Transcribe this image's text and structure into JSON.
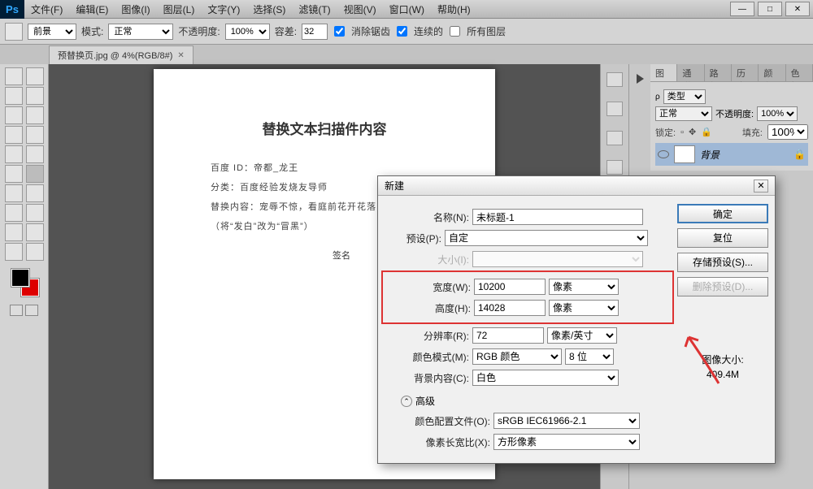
{
  "menu": {
    "file": "文件(F)",
    "edit": "编辑(E)",
    "image": "图像(I)",
    "layer": "图层(L)",
    "type": "文字(Y)",
    "select": "选择(S)",
    "filter": "滤镜(T)",
    "view": "视图(V)",
    "window": "窗口(W)",
    "help": "帮助(H)"
  },
  "options": {
    "fg": "前景",
    "mode": "模式:",
    "mode_val": "正常",
    "opacity": "不透明度:",
    "opacity_val": "100%",
    "tolerance": "容差:",
    "tol_val": "32",
    "antialias": "消除锯齿",
    "contig": "连续的",
    "allLayers": "所有图层"
  },
  "tab": {
    "title": "预替换页.jpg @ 4%(RGB/8#)"
  },
  "doc": {
    "title": "替换文本扫描件内容",
    "line1": "百度 ID：帝都_龙王",
    "line2": "分类：百度经验发烧友导师",
    "line3": "替换内容：宠辱不惊，看庭前花开花落！",
    "line4": "（将“发白”改为“冒黑”）",
    "sign": "签名"
  },
  "panels": {
    "tabs": {
      "layers": "图层",
      "channels": "通道",
      "paths": "路径",
      "history": "历史",
      "colors": "颜色",
      "swatches": "色板"
    },
    "kind": "类型",
    "blend": "正常",
    "opacity_l": "不透明度:",
    "opacity_v": "100%",
    "lock": "锁定:",
    "fill": "填充:",
    "fill_v": "100%",
    "layer0": "背景"
  },
  "dialog": {
    "title": "新建",
    "labels": {
      "name": "名称(N):",
      "preset": "预设(P):",
      "size": "大小(I):",
      "width": "宽度(W):",
      "height": "高度(H):",
      "res": "分辨率(R):",
      "cmode": "颜色模式(M):",
      "bg": "背景内容(C):",
      "adv": "高级",
      "profile": "颜色配置文件(O):",
      "aspect": "像素长宽比(X):"
    },
    "values": {
      "name": "未标题-1",
      "preset": "自定",
      "width": "10200",
      "height": "14028",
      "wunit": "像素",
      "hunit": "像素",
      "res": "72",
      "runit": "像素/英寸",
      "cmode": "RGB 颜色",
      "bits": "8 位",
      "bg": "白色",
      "profile": "sRGB IEC61966-2.1",
      "aspect": "方形像素"
    },
    "buttons": {
      "ok": "确定",
      "reset": "复位",
      "save": "存储预设(S)...",
      "del": "删除预设(D)..."
    },
    "size": {
      "label": "图像大小:",
      "value": "409.4M"
    }
  }
}
